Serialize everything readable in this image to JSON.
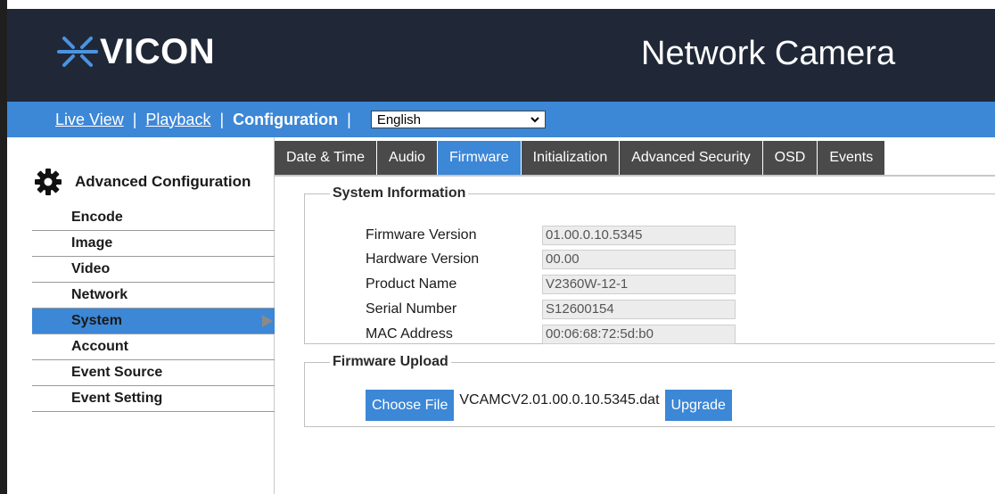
{
  "brand": {
    "name": "VICON"
  },
  "header": {
    "title": "Network Camera"
  },
  "nav": {
    "live_view": "Live View",
    "playback": "Playback",
    "configuration": "Configuration",
    "separator": "|",
    "language": "English"
  },
  "sidebar": {
    "title": "Advanced Configuration",
    "items": [
      {
        "label": "Encode"
      },
      {
        "label": "Image"
      },
      {
        "label": "Video"
      },
      {
        "label": "Network"
      },
      {
        "label": "System"
      },
      {
        "label": "Account"
      },
      {
        "label": "Event Source"
      },
      {
        "label": "Event Setting"
      }
    ]
  },
  "tabs": [
    {
      "label": "Date & Time"
    },
    {
      "label": "Audio"
    },
    {
      "label": "Firmware"
    },
    {
      "label": "Initialization"
    },
    {
      "label": "Advanced Security"
    },
    {
      "label": "OSD"
    },
    {
      "label": "Events"
    }
  ],
  "system_info": {
    "legend": "System Information",
    "rows": [
      {
        "label": "Firmware Version",
        "value": "01.00.0.10.5345"
      },
      {
        "label": "Hardware Version",
        "value": "00.00"
      },
      {
        "label": "Product Name",
        "value": "V2360W-12-1"
      },
      {
        "label": "Serial Number",
        "value": "S12600154"
      },
      {
        "label": "MAC Address",
        "value": "00:06:68:72:5d:b0"
      }
    ]
  },
  "firmware_upload": {
    "legend": "Firmware Upload",
    "choose_file": "Choose File",
    "file_name": "VCAMCV2.01.00.0.10.5345.dat",
    "upgrade": "Upgrade"
  },
  "colors": {
    "header_bg": "#202838",
    "accent": "#3c87d6",
    "tab_bg": "#4a4a4a",
    "logo_mark": "#3c87d6"
  },
  "icons": {
    "logo": "vicon-logo-icon",
    "settings": "gear-icon",
    "dropdown": "chevron-down-icon",
    "active": "triangle-right-icon"
  }
}
